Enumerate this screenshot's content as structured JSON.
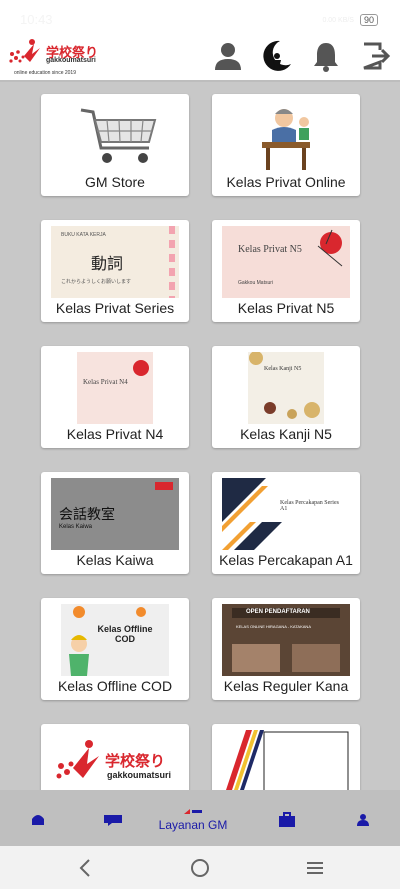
{
  "status_bar": {
    "time": "10:43",
    "network": "0.00 KB/S",
    "battery": "90"
  },
  "header": {
    "logo_text": "学校祭り",
    "logo_sub": "gakkoumatsuri",
    "logo_tag": "online education since 2019",
    "icons": [
      "user-icon",
      "moon-logo-icon",
      "bell-icon",
      "logout-icon"
    ]
  },
  "cards": [
    {
      "label": "GM Store"
    },
    {
      "label": "Kelas Privat Online"
    },
    {
      "label": "Kelas Privat Series",
      "thumb_title": "BUKU KATA KERJA",
      "thumb_kanji": "動詞",
      "thumb_sub": "これからようしくお願いします"
    },
    {
      "label": "Kelas Privat N5",
      "thumb_title": "Kelas Privat N5",
      "thumb_sub": "Gakkou Matsuri"
    },
    {
      "label": "Kelas Privat N4",
      "thumb_title": "Kelas Privat N4"
    },
    {
      "label": "Kelas Kanji N5",
      "thumb_title": "Kelas Kanji N5"
    },
    {
      "label": "Kelas Kaiwa",
      "thumb_kanji": "会話教室",
      "thumb_title": "Kelas Kaiwa"
    },
    {
      "label": "Kelas Percakapan A1",
      "thumb_title": "Kelas Percakapan Series A1"
    },
    {
      "label": "Kelas Offline COD",
      "thumb_title": "Kelas Offline COD"
    },
    {
      "label": "Kelas Reguler Kana",
      "thumb_title": "OPEN PENDAFTARAN",
      "thumb_sub": "KELAS ONLINE HIRAGANA - KATAKANA"
    },
    {
      "label": "",
      "thumb_title": "学校祭り",
      "thumb_sub": "gakkoumatsuri"
    },
    {
      "label": ""
    }
  ],
  "bottom_nav": {
    "active_label": "Layanan GM",
    "items": [
      "home-icon",
      "chat-icon",
      "layanan-gm",
      "briefcase-icon",
      "profile-icon"
    ]
  },
  "colors": {
    "nav_text": "#1a1aa8",
    "brand_red": "#d9272e",
    "background": "#c8c8c8"
  }
}
